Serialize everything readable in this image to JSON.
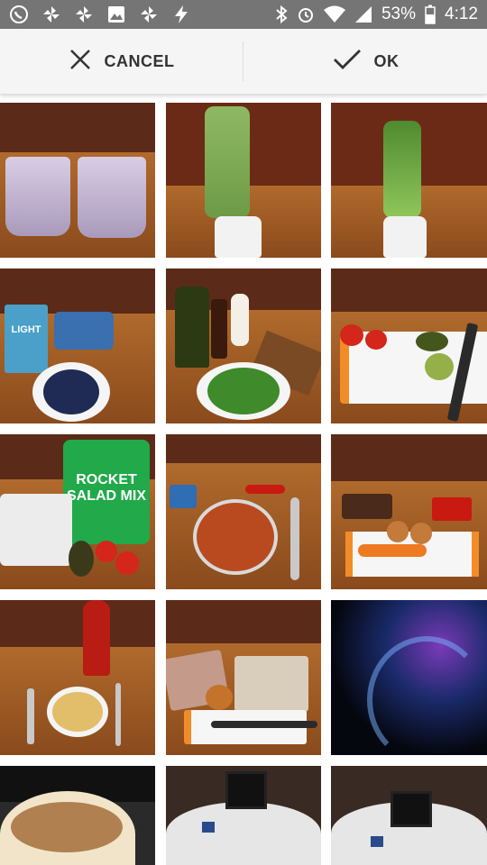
{
  "status_bar": {
    "battery": "53%",
    "time": "4:12",
    "left_icons": [
      "whatsapp-icon",
      "pinwheel-icon",
      "pinwheel-icon",
      "image-icon",
      "pinwheel-icon",
      "flash-icon"
    ],
    "right_icons": [
      "bluetooth-icon",
      "alarm-icon",
      "wifi-icon",
      "signal-icon",
      "battery-icon"
    ]
  },
  "action_bar": {
    "cancel_label": "CANCEL",
    "ok_label": "OK"
  },
  "photos": [
    {
      "name": "photo-smoothies-two-glasses",
      "text": ""
    },
    {
      "name": "photo-green-blender",
      "text": ""
    },
    {
      "name": "photo-green-blender-leaves",
      "text": ""
    },
    {
      "name": "photo-milk-blueberries",
      "text": "LIGHT"
    },
    {
      "name": "photo-spinach-salad-oil",
      "text": ""
    },
    {
      "name": "photo-tomatoes-avocado-knife",
      "text": ""
    },
    {
      "name": "photo-eggs-rocket-salad",
      "text": "ROCKET SALAD MIX"
    },
    {
      "name": "photo-bowl-stew-spoon",
      "text": ""
    },
    {
      "name": "photo-spices-onions-carrot",
      "text": ""
    },
    {
      "name": "photo-ketchup-pancake",
      "text": ""
    },
    {
      "name": "photo-pastry-onion-knife",
      "text": ""
    },
    {
      "name": "photo-abstract-dark-wallpaper",
      "text": ""
    },
    {
      "name": "photo-coffee-cup-keyboard",
      "text": ""
    },
    {
      "name": "photo-laptop-desk-1",
      "text": ""
    },
    {
      "name": "photo-laptop-desk-2",
      "text": ""
    }
  ],
  "colors": {
    "status_bar": "#757575",
    "action_bar": "#f5f5f5",
    "wood_wall": "#6b2e1b",
    "wood_table": "#a55f28"
  }
}
